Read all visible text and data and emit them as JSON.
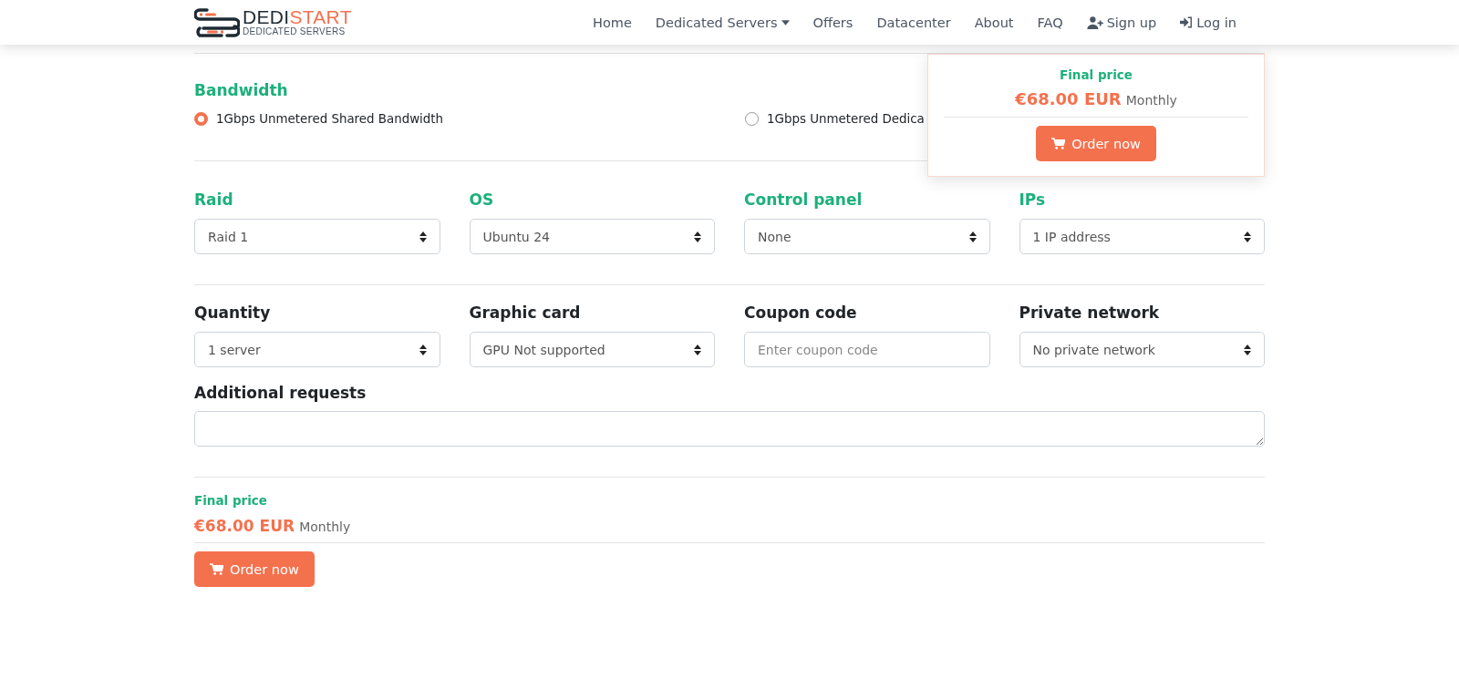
{
  "logo": {
    "brand_first": "DEDI",
    "brand_second": "START",
    "tagline": "DEDICATED SERVERS"
  },
  "nav": [
    {
      "label": "Home",
      "kind": "link"
    },
    {
      "label": "Dedicated Servers",
      "kind": "dropdown"
    },
    {
      "label": "Offers",
      "kind": "link"
    },
    {
      "label": "Datacenter",
      "kind": "link"
    },
    {
      "label": "About",
      "kind": "link"
    },
    {
      "label": "FAQ",
      "kind": "link"
    },
    {
      "label": "Sign up",
      "kind": "signup"
    },
    {
      "label": "Log in",
      "kind": "login"
    }
  ],
  "bandwidth": {
    "title": "Bandwidth",
    "options": [
      {
        "label": "1Gbps Unmetered Shared Bandwidth",
        "selected": true
      },
      {
        "label": "1Gbps Unmetered Dedica",
        "selected": false
      }
    ]
  },
  "option_rows": [
    {
      "fields": [
        {
          "label": "Raid",
          "accent": true,
          "kind": "select",
          "value": "Raid 1"
        },
        {
          "label": "OS",
          "accent": true,
          "kind": "select",
          "value": "Ubuntu 24"
        },
        {
          "label": "Control panel",
          "accent": true,
          "kind": "select",
          "value": "None"
        },
        {
          "label": "IPs",
          "accent": true,
          "kind": "select",
          "value": "1 IP address"
        }
      ]
    },
    {
      "fields": [
        {
          "label": "Quantity",
          "accent": false,
          "kind": "select",
          "value": "1 server"
        },
        {
          "label": "Graphic card",
          "accent": false,
          "kind": "select",
          "value": "GPU Not supported"
        },
        {
          "label": "Coupon code",
          "accent": false,
          "kind": "input",
          "placeholder": "Enter coupon code"
        },
        {
          "label": "Private network",
          "accent": false,
          "kind": "select",
          "value": "No private network"
        }
      ]
    }
  ],
  "additional_requests": {
    "label": "Additional requests"
  },
  "summary": {
    "title": "Final price",
    "price": "€68.00 EUR",
    "period": "Monthly",
    "button": "Order now"
  },
  "floating_card": {
    "title": "Final price",
    "price": "€68.00 EUR",
    "period": "Monthly",
    "button": "Order now"
  }
}
